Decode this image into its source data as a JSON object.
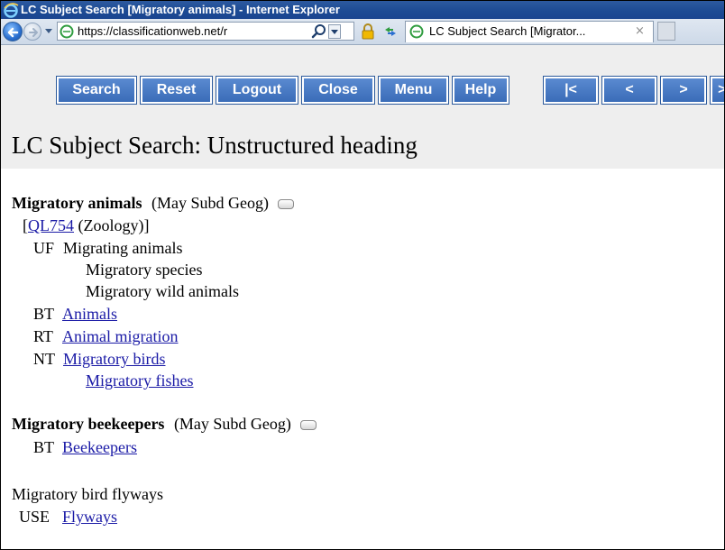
{
  "window": {
    "title": "LC Subject Search [Migratory animals] - Internet Explorer",
    "icon": "ie-logo-icon"
  },
  "addressbar": {
    "url": "https://classificationweb.net/r",
    "tab_title": "LC Subject Search [Migrator...",
    "tab_close": "×"
  },
  "toolbar": {
    "buttons": {
      "search": "Search",
      "reset": "Reset",
      "logout": "Logout",
      "close": "Close",
      "menu": "Menu",
      "help": "Help",
      "first": "|<",
      "prev": "<",
      "next": ">",
      "last": ">|"
    },
    "button_color": "#3a6cb8"
  },
  "page": {
    "title": "LC Subject Search: Unstructured heading"
  },
  "entries": [
    {
      "heading": "Migratory animals",
      "qualifier": "(May Subd Geog)",
      "class_open": "[",
      "class_number": "QL754",
      "class_label": "(Zoology)]",
      "uf_label": "UF",
      "uf": [
        "Migrating animals",
        "Migratory species",
        "Migratory wild animals"
      ],
      "bt_label": "BT",
      "bt": [
        "Animals"
      ],
      "rt_label": "RT",
      "rt": [
        "Animal migration"
      ],
      "nt_label": "NT",
      "nt": [
        "Migratory birds",
        "Migratory fishes"
      ]
    },
    {
      "heading": "Migratory beekeepers",
      "qualifier": "(May Subd Geog)",
      "bt_label": "BT",
      "bt": [
        "Beekeepers"
      ]
    },
    {
      "heading": "Migratory bird flyways",
      "use_label": "USE",
      "use": [
        "Flyways"
      ]
    }
  ],
  "colors": {
    "link": "#1a1aa6",
    "titlebar": "#1c4a94"
  }
}
